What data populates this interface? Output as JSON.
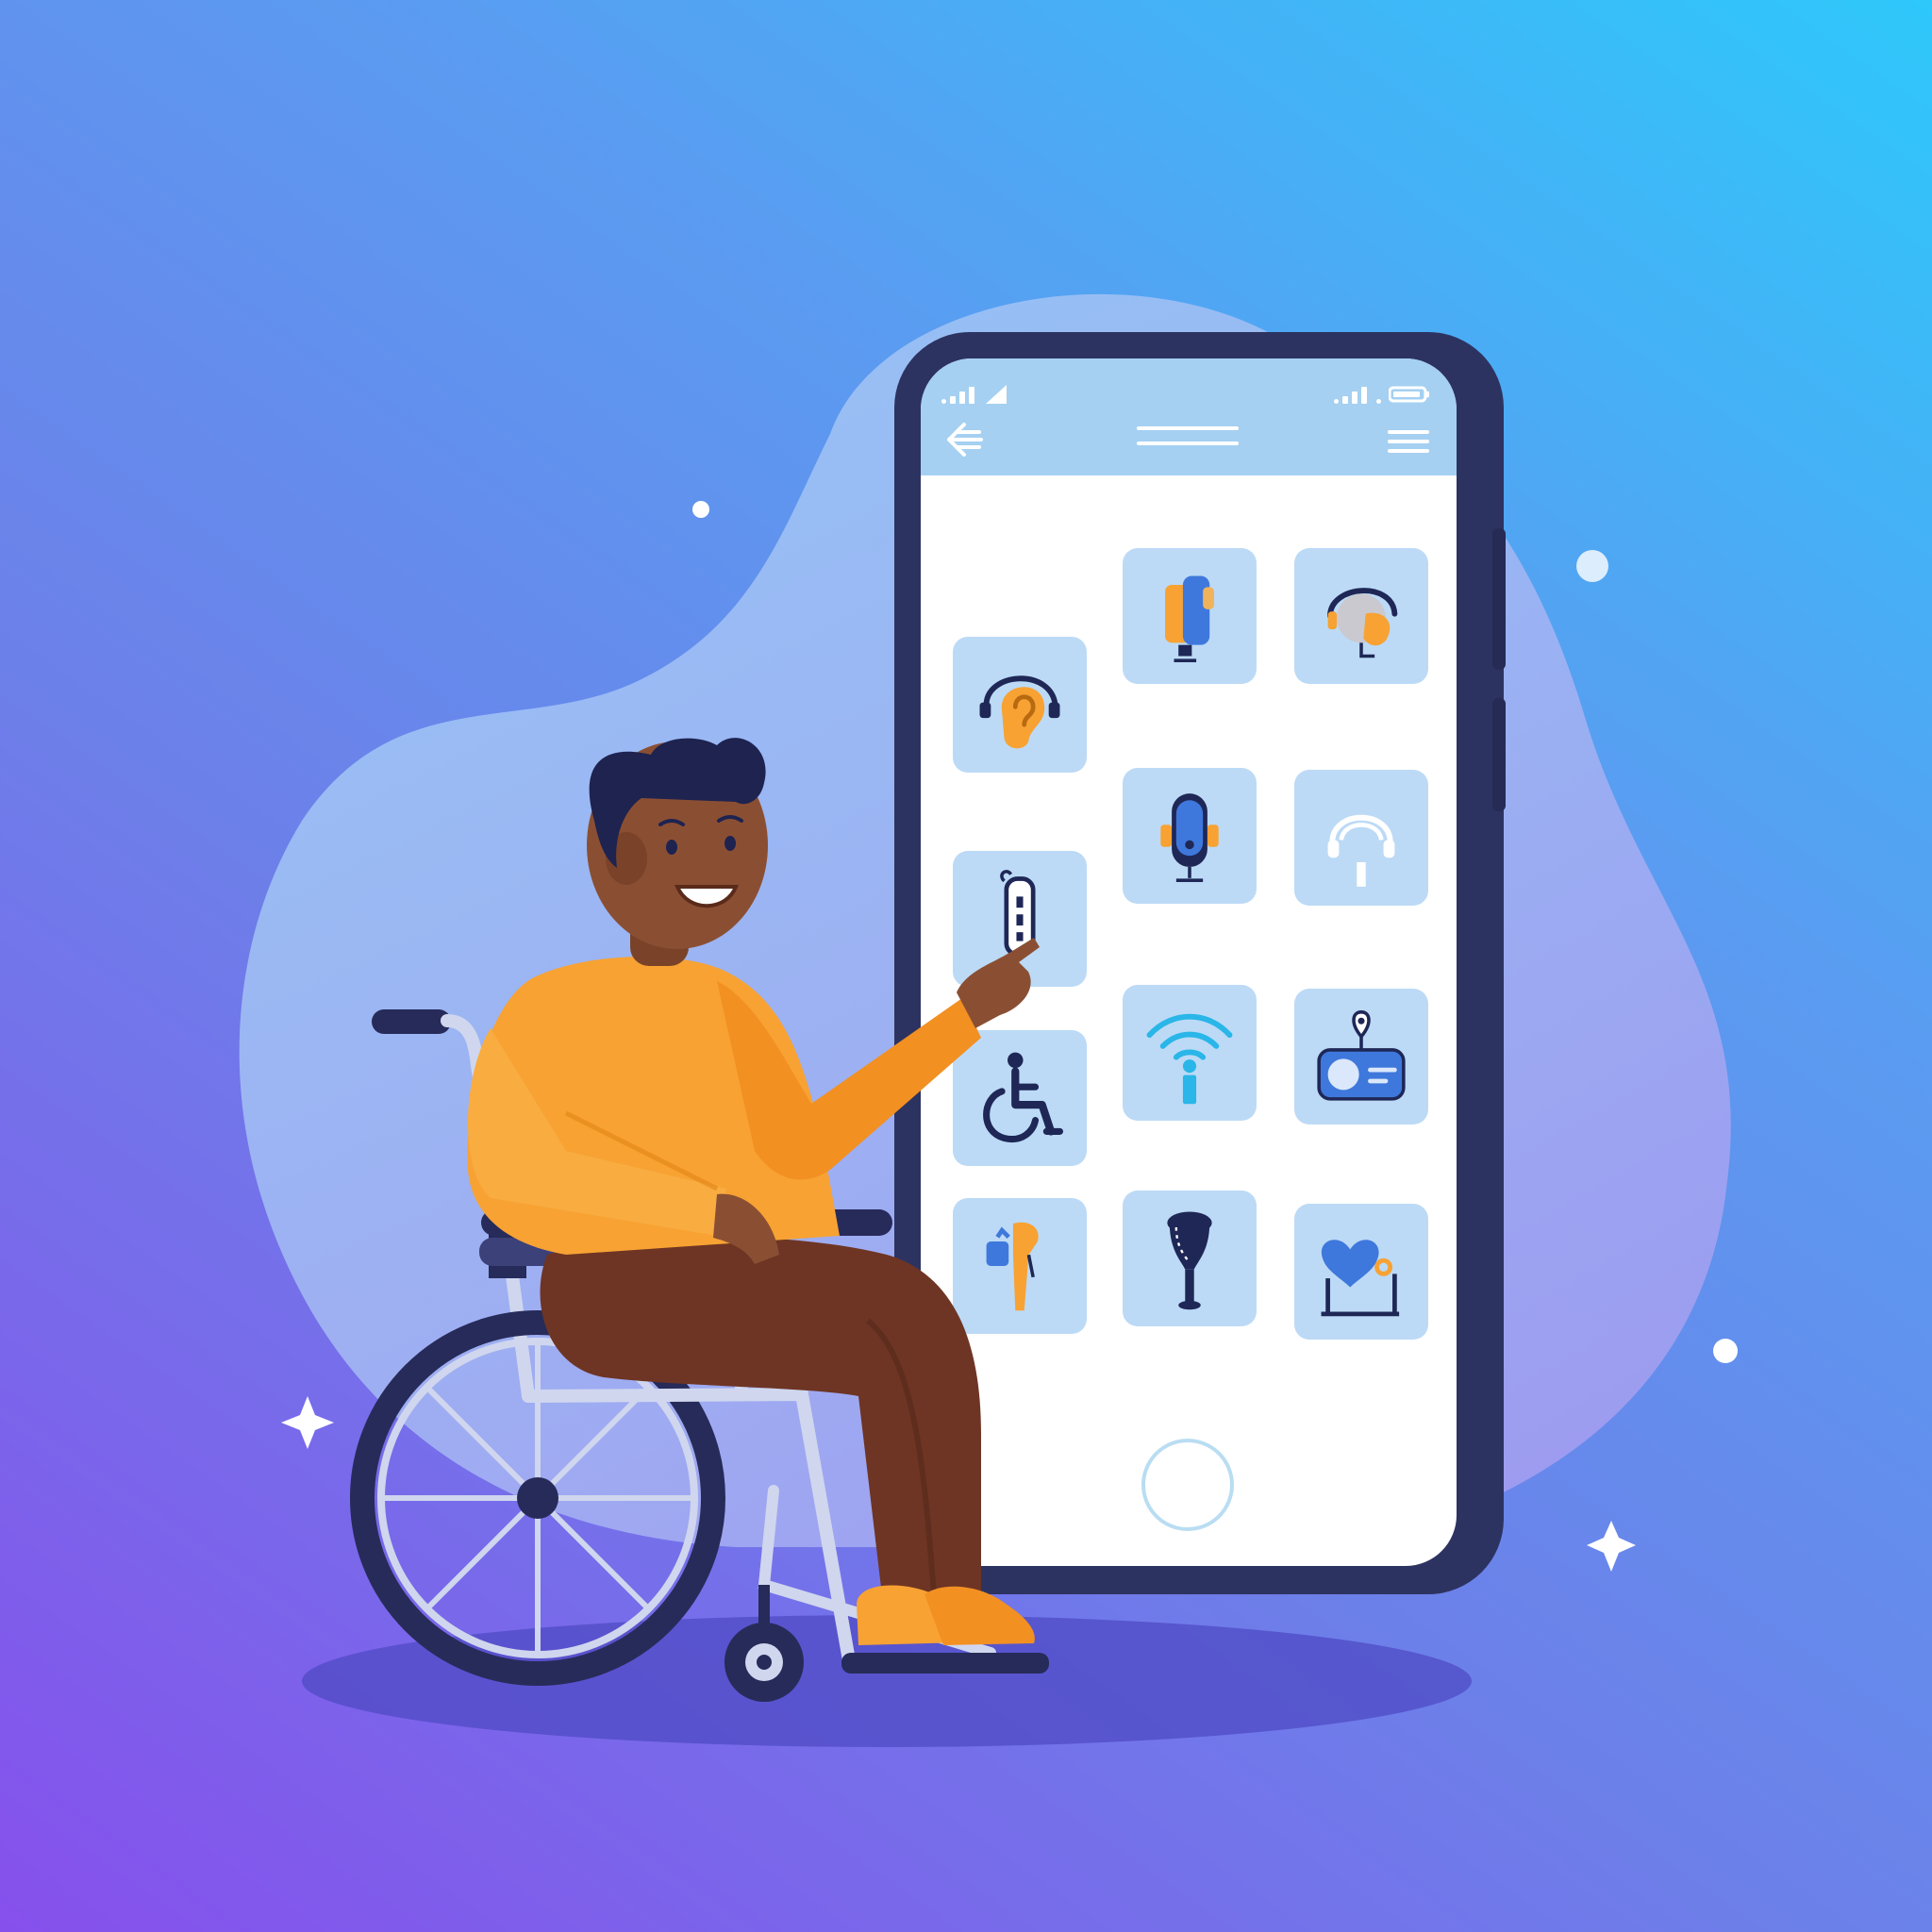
{
  "colors": {
    "background_top_right": "#2ec8fb",
    "background_bottom_left": "#8650ec",
    "blob": "#a8c2f5",
    "phone_frame": "#2d3361",
    "app_header": "#a5d0f1",
    "tile": "#bcdaf6",
    "sweater": "#f7a233",
    "trousers": "#6e3524",
    "skin": "#8a4f33",
    "hair": "#1e2350",
    "wheelchair_frame": "#cfd6ee",
    "wheelchair_tyre": "#272b59",
    "icon_orange": "#f7a233",
    "icon_blue": "#3f78dc",
    "icon_navy": "#1e2756",
    "icon_cyan": "#2ab6e8"
  },
  "phone": {
    "header_icons": [
      "signal-icon",
      "back-arrow-icon",
      "title-lines",
      "menu-icon",
      "battery-icon"
    ],
    "tiles": [
      {
        "name": "tile-hearing-aid",
        "icon": "ear-icon"
      },
      {
        "name": "tile-audio-device",
        "icon": "audio-device-icon"
      },
      {
        "name": "tile-headset",
        "icon": "headset-icon"
      },
      {
        "name": "tile-microphone",
        "icon": "microphone-icon"
      },
      {
        "name": "tile-listening",
        "icon": "listening-headphones-icon"
      },
      {
        "name": "tile-device-control",
        "icon": "device-control-icon"
      },
      {
        "name": "tile-wheelchair",
        "icon": "wheelchair-icon"
      },
      {
        "name": "tile-wireless-info",
        "icon": "wireless-info-icon"
      },
      {
        "name": "tile-location-device",
        "icon": "location-radio-icon"
      },
      {
        "name": "tile-prosthetic",
        "icon": "prosthetic-arm-icon"
      },
      {
        "name": "tile-walking-cane",
        "icon": "walking-cane-icon"
      },
      {
        "name": "tile-health-walker",
        "icon": "heart-walker-icon"
      }
    ]
  },
  "decorations": [
    "sparkle-icon",
    "sparkle-icon",
    "dot",
    "dot",
    "dot"
  ]
}
